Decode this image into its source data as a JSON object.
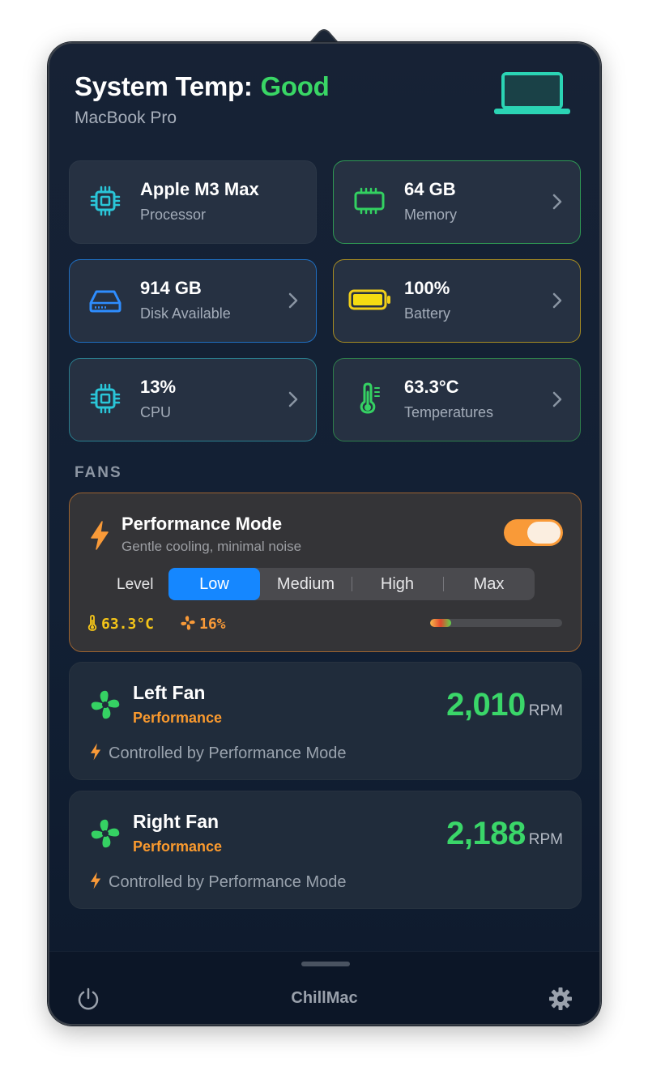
{
  "header": {
    "title": "System Temp:",
    "status": "Good",
    "device": "MacBook Pro"
  },
  "cards": {
    "processor": {
      "value": "Apple M3 Max",
      "label": "Processor"
    },
    "memory": {
      "value": "64 GB",
      "label": "Memory"
    },
    "disk": {
      "value": "914 GB",
      "label": "Disk Available"
    },
    "battery": {
      "value": "100%",
      "label": "Battery"
    },
    "cpu": {
      "value": "13%",
      "label": "CPU"
    },
    "temperatures": {
      "value": "63.3°C",
      "label": "Temperatures"
    }
  },
  "fans_section": {
    "title": "FANS"
  },
  "performance": {
    "title": "Performance Mode",
    "subtitle": "Gentle cooling, minimal noise",
    "enabled": true,
    "level_label": "Level",
    "levels": [
      "Low",
      "Medium",
      "High",
      "Max"
    ],
    "selected_level": "Low",
    "temp": "63.3°C",
    "fan_percent": "16%",
    "fan_fraction": 0.16
  },
  "fans": [
    {
      "name": "Left Fan",
      "mode": "Performance",
      "rpm": "2,010",
      "unit": "RPM",
      "control": "Controlled by Performance Mode"
    },
    {
      "name": "Right Fan",
      "mode": "Performance",
      "rpm": "2,188",
      "unit": "RPM",
      "control": "Controlled by Performance Mode"
    }
  ],
  "footer": {
    "app_name": "ChillMac"
  },
  "colors": {
    "good": "#39d665",
    "accent_orange": "#f99a38",
    "selected_blue": "#1587ff",
    "rpm_green": "#3ad669"
  },
  "icons": {
    "processor": "cpu-chip-icon",
    "memory": "memory-chip-icon",
    "disk": "disk-drive-icon",
    "battery": "battery-icon",
    "cpu": "cpu-chip-icon",
    "temperatures": "thermometer-icon",
    "performance": "lightning-bolt-icon",
    "fan": "fan-icon",
    "power": "power-icon",
    "settings": "gear-icon",
    "device": "laptop-icon"
  }
}
